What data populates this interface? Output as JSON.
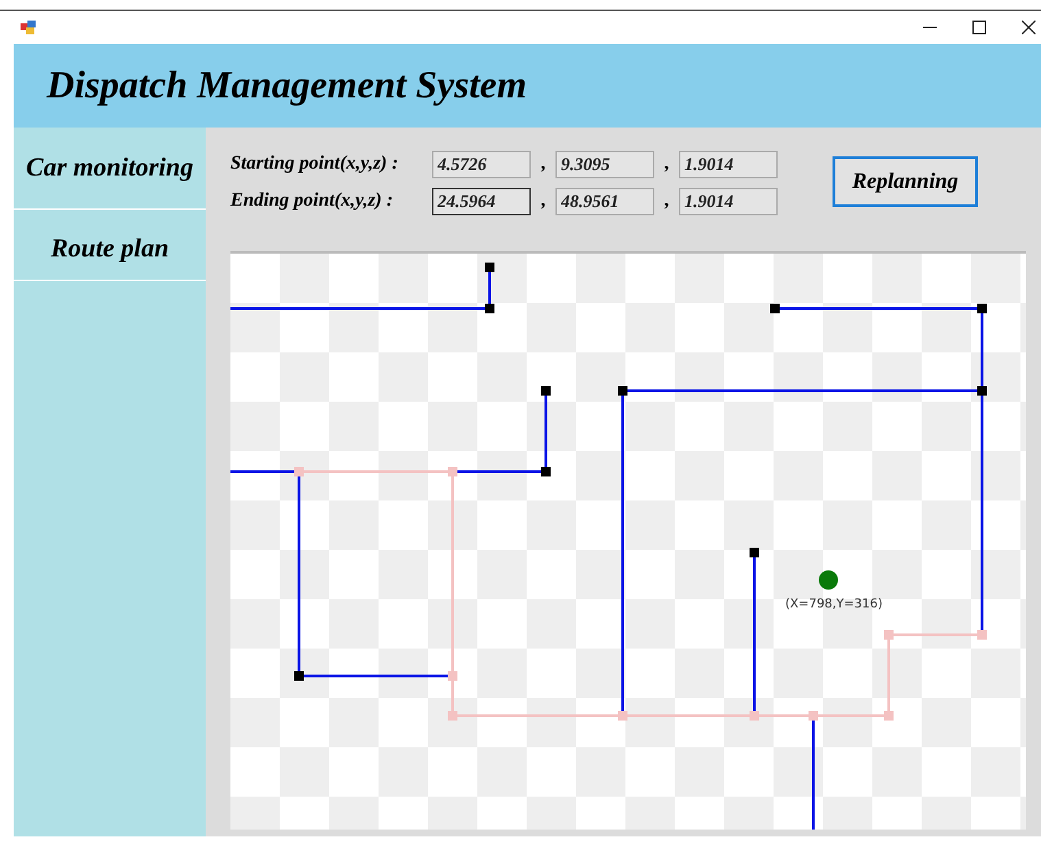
{
  "window": {
    "controls": [
      {
        "kind": "minimize"
      },
      {
        "kind": "maximize"
      },
      {
        "kind": "close"
      }
    ]
  },
  "header": {
    "title": "Dispatch Management System"
  },
  "sidebar": {
    "items": [
      {
        "label": "Car monitoring"
      },
      {
        "label": "Route plan"
      }
    ]
  },
  "points": [
    {
      "label": "Starting point(x,y,z) :",
      "fields": [
        {
          "value": "4.5726",
          "focused": false
        },
        {
          "value": "9.3095",
          "focused": false
        },
        {
          "value": "1.9014",
          "focused": false
        }
      ],
      "separators": [
        ",",
        ","
      ]
    },
    {
      "label": "Ending point(x,y,z) :",
      "fields": [
        {
          "value": "24.5964",
          "focused": true
        },
        {
          "value": "48.9561",
          "focused": false
        },
        {
          "value": "1.9014",
          "focused": false
        }
      ],
      "separators": [
        ",",
        ","
      ]
    }
  ],
  "replan_button": {
    "label": "Replanning"
  },
  "map": {
    "marker_label": "(X=798,Y=316)"
  }
}
